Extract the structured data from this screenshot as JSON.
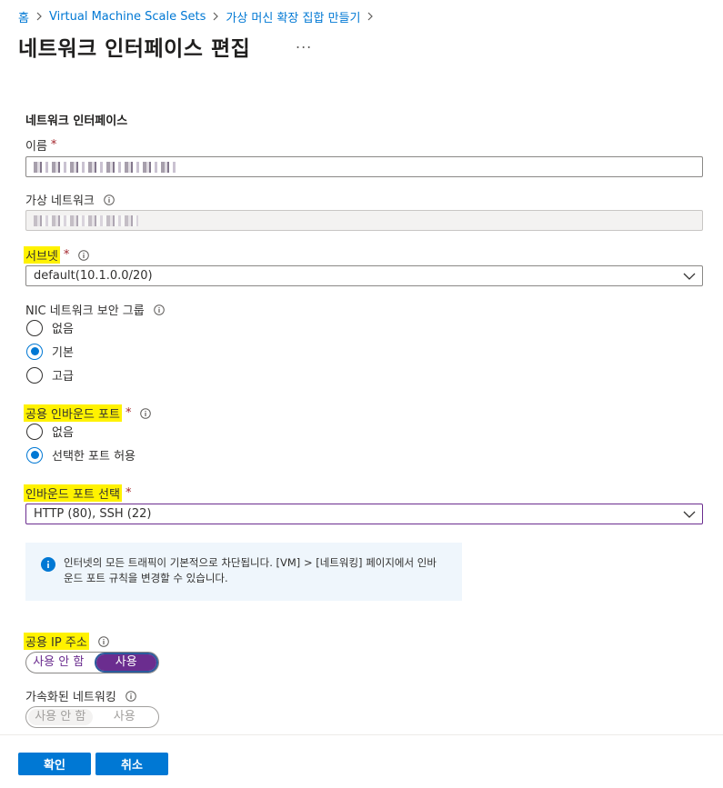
{
  "breadcrumb": {
    "items": [
      "홈",
      "Virtual Machine Scale Sets",
      "가상 머신 확장 집합 만들기"
    ]
  },
  "page": {
    "title": "네트워크 인터페이스 편집",
    "more": "..."
  },
  "section": {
    "title": "네트워크 인터페이스"
  },
  "name_field": {
    "label": "이름",
    "required_mark": "*"
  },
  "vnet_field": {
    "label": "가상 네트워크"
  },
  "subnet_field": {
    "label": "서브넷",
    "required_mark": "*",
    "value": "default(10.1.0.0/20)"
  },
  "nsg": {
    "label": "NIC 네트워크 보안 그룹",
    "options": [
      "없음",
      "기본",
      "고급"
    ],
    "selected": "기본"
  },
  "public_ports": {
    "label": "공용 인바운드 포트",
    "required_mark": "*",
    "options": [
      "없음",
      "선택한 포트 허용"
    ],
    "selected": "선택한 포트 허용"
  },
  "inbound_ports": {
    "label": "인바운드 포트 선택",
    "required_mark": "*",
    "value": "HTTP (80), SSH (22)"
  },
  "info": {
    "text": "인터넷의 모든 트래픽이 기본적으로 차단됩니다. [VM] > [네트워킹] 페이지에서 인바운드 포트 규칙을 변경할 수 있습니다."
  },
  "public_ip": {
    "label": "공용 IP 주소",
    "off": "사용 안 함",
    "on": "사용",
    "selected": "사용"
  },
  "accel": {
    "label": "가속화된 네트워킹",
    "off": "사용 안 함",
    "on": "사용",
    "selected": "사용 안 함"
  },
  "footer": {
    "ok": "확인",
    "cancel": "취소"
  },
  "colors": {
    "accent": "#0078d4",
    "highlight": "#fff200",
    "toggle_on": "#6b2d8f",
    "required": "#a4262c"
  }
}
